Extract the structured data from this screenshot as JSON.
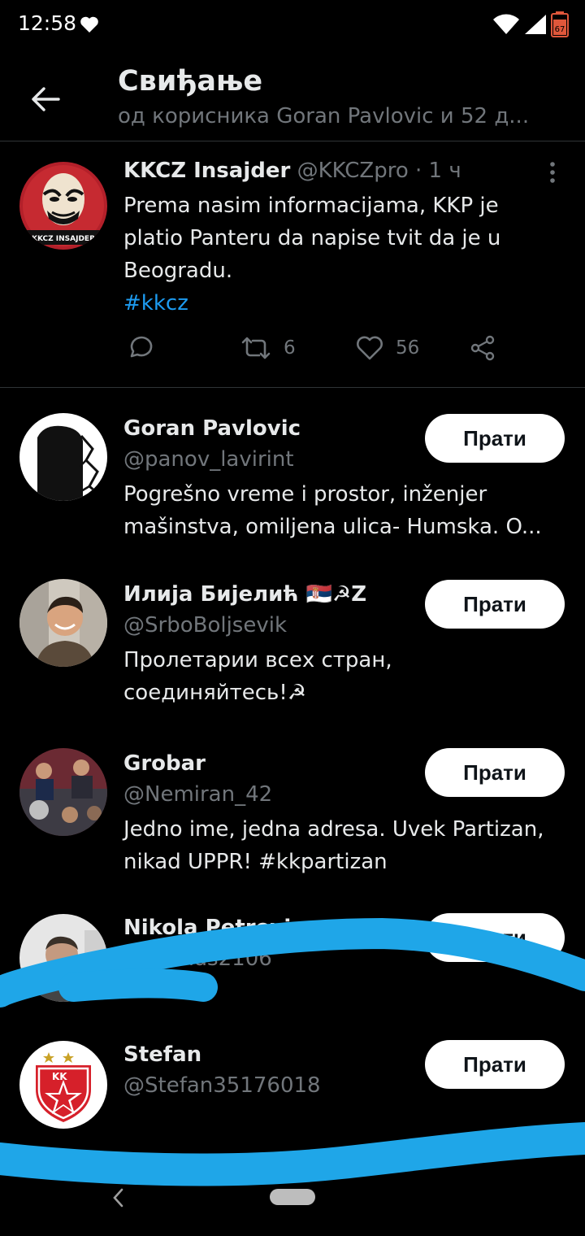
{
  "status": {
    "time": "12:58",
    "battery": "67",
    "icons": [
      "heart-icon",
      "wifi-icon",
      "signal-icon",
      "battery-icon"
    ]
  },
  "header": {
    "title": "Свиђање",
    "subtitle": "од корисника Goran Pavlovic и 52 д..."
  },
  "tweet": {
    "author": "KKCZ Insajder",
    "handle": "@KKCZpro",
    "dot": "·",
    "time": "1 ч",
    "text": "Prema nasim informacijama, KKP je platio Panteru da napise tvit da je u Beogradu.",
    "hashtag": "#kkcz",
    "avatar_text": "KKCZ INSAJDER",
    "retweets": "6",
    "likes": "56"
  },
  "follow_label": "Прати",
  "users": [
    {
      "name": "Goran Pavlovic",
      "handle": "@panov_lavirint",
      "bio": "Pogrešno vreme i prostor, inženjer mašinstva, omiljena ulica- Humska. O..."
    },
    {
      "name": "Илија Бијелић 🇷🇸☭Z",
      "handle": "@SrboBoljsevik",
      "bio": "Пролетарии всех стран, соединяйтесь!☭"
    },
    {
      "name": "Grobar",
      "handle": "@Nemiran_42",
      "bio": "Jedno ime, jedna adresa. Uvek Partizan, nikad UPPR! #kkpartizan"
    },
    {
      "name": "Nikola Petrovic",
      "handle": "@nicolas2106",
      "bio": ""
    },
    {
      "name": "Stefan",
      "handle": "@Stefan35176018",
      "bio": "",
      "avatar_text": "KK"
    }
  ],
  "colors": {
    "background": "#000000",
    "accent": "#1d9bf0",
    "scribble": "#1fa6e8",
    "muted": "#71767b"
  }
}
